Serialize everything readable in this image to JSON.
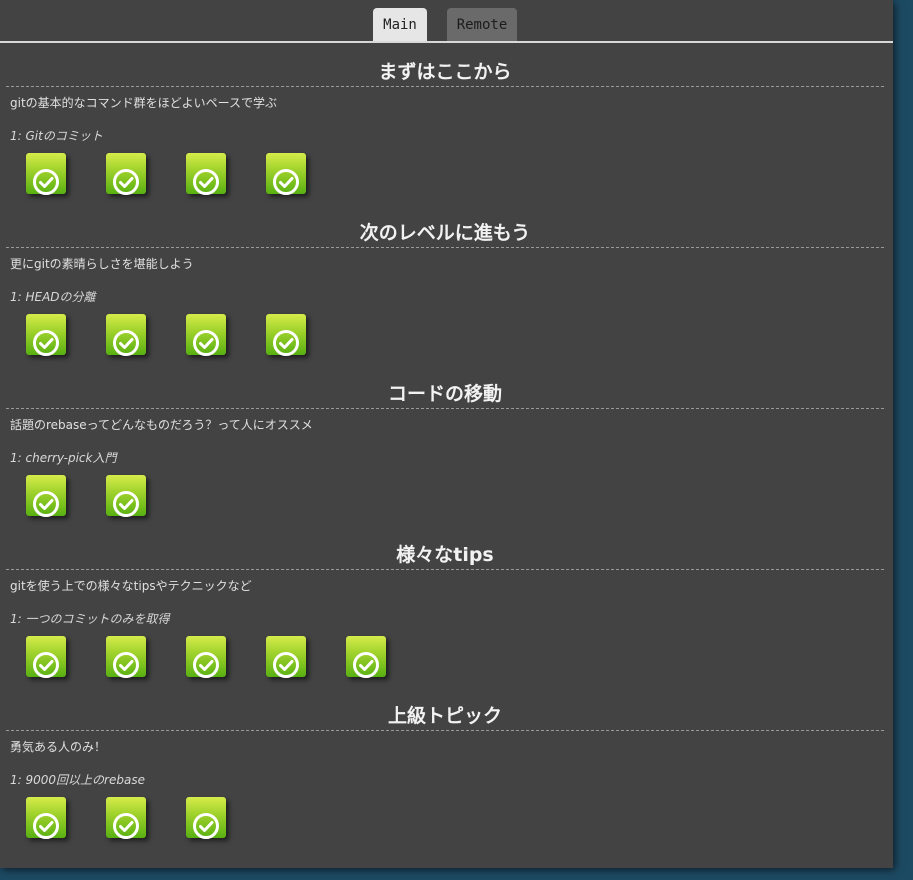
{
  "tabs": {
    "main_label": "Main",
    "remote_label": "Remote"
  },
  "icons": {
    "level_complete": "check-circle-icon",
    "level_color_top": "#d6ec4a",
    "level_color_bottom": "#58b012"
  },
  "sequences": [
    {
      "title": "まずはここから",
      "description": "gitの基本的なコマンド群をほどよいペースで学ぶ",
      "first_level": "1: Gitのコミット",
      "levels_completed": 4
    },
    {
      "title": "次のレベルに進もう",
      "description": "更にgitの素晴らしさを堪能しよう",
      "first_level": "1: HEADの分離",
      "levels_completed": 4
    },
    {
      "title": "コードの移動",
      "description": "話題のrebaseってどんなものだろう？って人にオススメ",
      "first_level": "1: cherry-pick入門",
      "levels_completed": 2
    },
    {
      "title": "様々なtips",
      "description": "gitを使う上での様々なtipsやテクニックなど",
      "first_level": "1: 一つのコミットのみを取得",
      "levels_completed": 5
    },
    {
      "title": "上級トピック",
      "description": "勇気ある人のみ！",
      "first_level": "1: 9000回以上のrebase",
      "levels_completed": 3
    }
  ]
}
